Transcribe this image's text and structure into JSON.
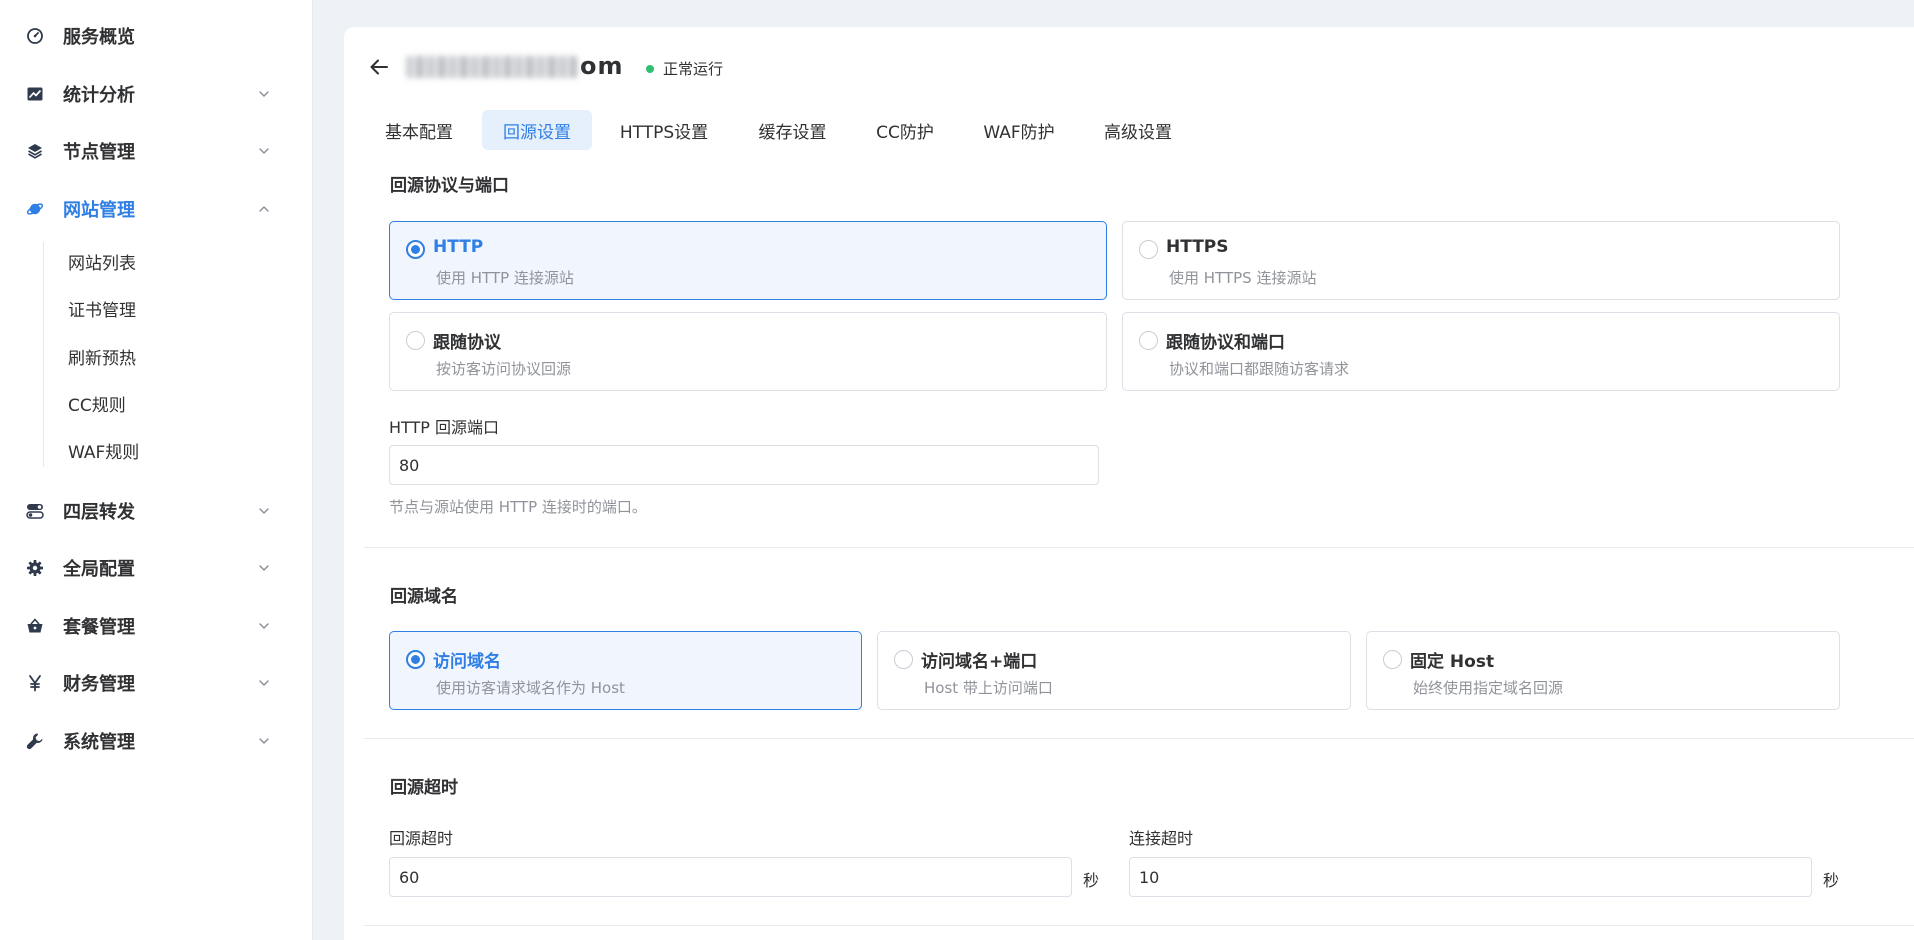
{
  "colors": {
    "accent": "#2f7fe4",
    "status_ok": "#2fbf71",
    "selected_bg": "#f1f6fe",
    "page_bg": "#eef1f6"
  },
  "sidebar": {
    "items": [
      {
        "label": "服务概览",
        "icon": "dashboard-icon"
      },
      {
        "label": "统计分析",
        "icon": "chart-icon"
      },
      {
        "label": "节点管理",
        "icon": "layers-icon"
      },
      {
        "label": "网站管理",
        "icon": "planet-icon",
        "expanded": true
      },
      {
        "label": "四层转发",
        "icon": "toggle-icon"
      },
      {
        "label": "全局配置",
        "icon": "gear-icon"
      },
      {
        "label": "套餐管理",
        "icon": "basket-icon"
      },
      {
        "label": "财务管理",
        "icon": "yen-icon"
      },
      {
        "label": "系统管理",
        "icon": "wrench-icon"
      }
    ],
    "sub_items": [
      "网站列表",
      "证书管理",
      "刷新预热",
      "CC规则",
      "WAF规则"
    ]
  },
  "header": {
    "site_name_visible": "om",
    "status": "正常运行"
  },
  "tabs": [
    {
      "label": "基本配置"
    },
    {
      "label": "回源设置",
      "active": true
    },
    {
      "label": "HTTPS设置"
    },
    {
      "label": "缓存设置"
    },
    {
      "label": "CC防护"
    },
    {
      "label": "WAF防护"
    },
    {
      "label": "高级设置"
    }
  ],
  "protocol": {
    "title": "回源协议与端口",
    "options": [
      {
        "title": "HTTP",
        "desc": "使用 HTTP 连接源站",
        "selected": true
      },
      {
        "title": "HTTPS",
        "desc": "使用 HTTPS 连接源站"
      },
      {
        "title": "跟随协议",
        "desc": "按访客访问协议回源"
      },
      {
        "title": "跟随协议和端口",
        "desc": "协议和端口都跟随访客请求"
      }
    ],
    "port_label": "HTTP 回源端口",
    "port_value": "80",
    "port_hint": "节点与源站使用 HTTP 连接时的端口。"
  },
  "host": {
    "title": "回源域名",
    "options": [
      {
        "title": "访问域名",
        "desc": "使用访客请求域名作为 Host",
        "selected": true
      },
      {
        "title": "访问域名+端口",
        "desc": "Host 带上访问端口"
      },
      {
        "title": "固定 Host",
        "desc": "始终使用指定域名回源"
      }
    ]
  },
  "timeout": {
    "title": "回源超时",
    "origin_label": "回源超时",
    "origin_value": "60",
    "connect_label": "连接超时",
    "connect_value": "10",
    "unit": "秒"
  }
}
